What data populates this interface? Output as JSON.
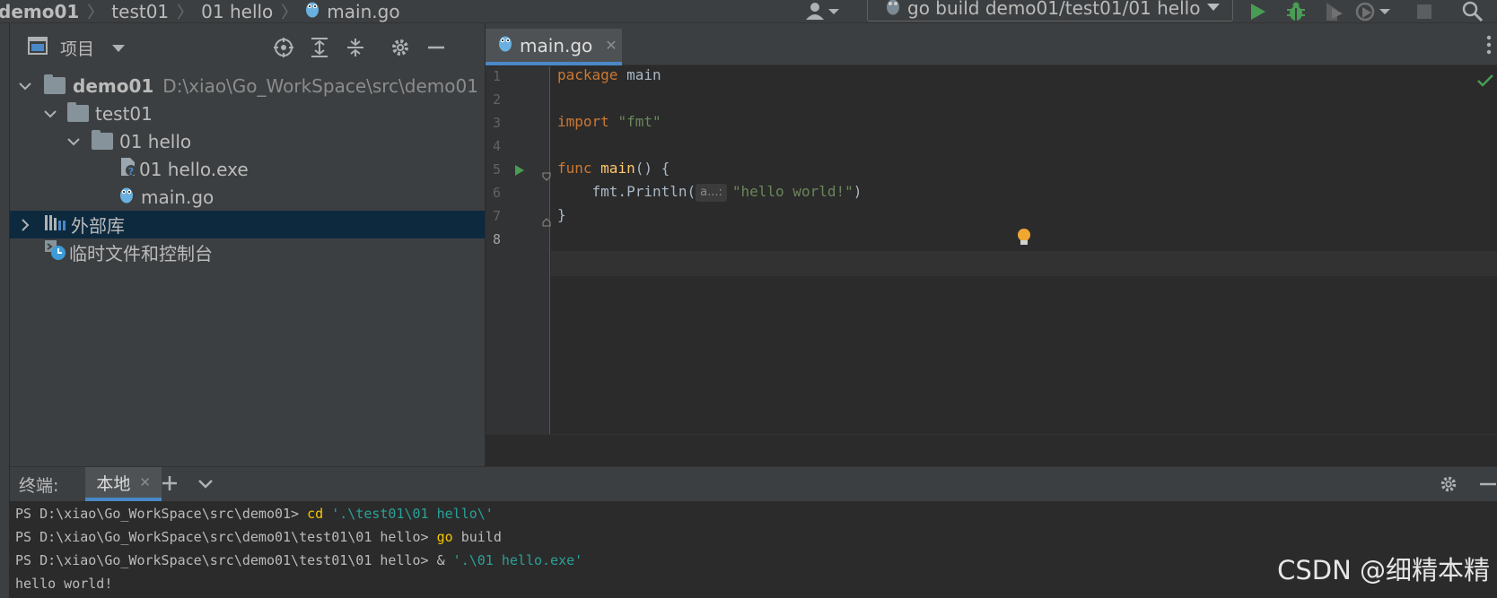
{
  "navbar": {
    "crumbs": [
      "demo01",
      "test01",
      "01 hello",
      "main.go"
    ],
    "run_config": "go build demo01/test01/01 hello"
  },
  "colors": {
    "accent": "#4a88c7",
    "run_green": "#499c54",
    "debug_green": "#499c54",
    "selection": "#0d293e",
    "keyword": "#cc7832",
    "function": "#ffc66d",
    "string": "#6a8759",
    "terminal_command": "#f7c500",
    "terminal_string": "#2aa198"
  },
  "project": {
    "title": "项目",
    "tree": [
      {
        "label": "demo01",
        "hint": "D:\\xiao\\Go_WorkSpace\\src\\demo01",
        "icon": "folder-icon",
        "expanded": true
      },
      {
        "label": "test01",
        "icon": "folder-icon",
        "expanded": true
      },
      {
        "label": "01 hello",
        "icon": "folder-icon",
        "expanded": true
      },
      {
        "label": "01 hello.exe",
        "icon": "unknown-file-icon"
      },
      {
        "label": "main.go",
        "icon": "go-file-icon"
      },
      {
        "label": "外部库",
        "icon": "library-icon",
        "expanded": false,
        "selected": true
      },
      {
        "label": "临时文件和控制台",
        "icon": "scratches-icon"
      }
    ]
  },
  "editor": {
    "tab": "main.go",
    "line_numbers": [
      "1",
      "2",
      "3",
      "4",
      "5",
      "6",
      "7",
      "8"
    ],
    "code": {
      "l1_kw": "package",
      "l1_rest": " main",
      "l3_kw": "import",
      "l3_str": "\"fmt\"",
      "l5_kw": "func",
      "l5_fn": "main",
      "l5_rest": "() {",
      "l6_indent": "    ",
      "l6_call": "fmt.Println(",
      "l6_hint": "a...:",
      "l6_str": "\"hello world!\"",
      "l6_close": ")",
      "l7": "}"
    }
  },
  "terminal": {
    "label": "终端:",
    "tab": "本地",
    "lines": [
      {
        "prompt": "PS D:\\xiao\\Go_WorkSpace\\src\\demo01> ",
        "cmd": "cd",
        "arg": " '.\\test01\\01 hello\\'"
      },
      {
        "prompt": "PS D:\\xiao\\Go_WorkSpace\\src\\demo01\\test01\\01 hello> ",
        "cmd": "go",
        "arg": " build"
      },
      {
        "prompt": "PS D:\\xiao\\Go_WorkSpace\\src\\demo01\\test01\\01 hello> ",
        "cmd": "&",
        "arg": " '.\\01 hello.exe'"
      },
      {
        "output": "hello world!"
      }
    ]
  },
  "watermark": "CSDN @细精本精"
}
